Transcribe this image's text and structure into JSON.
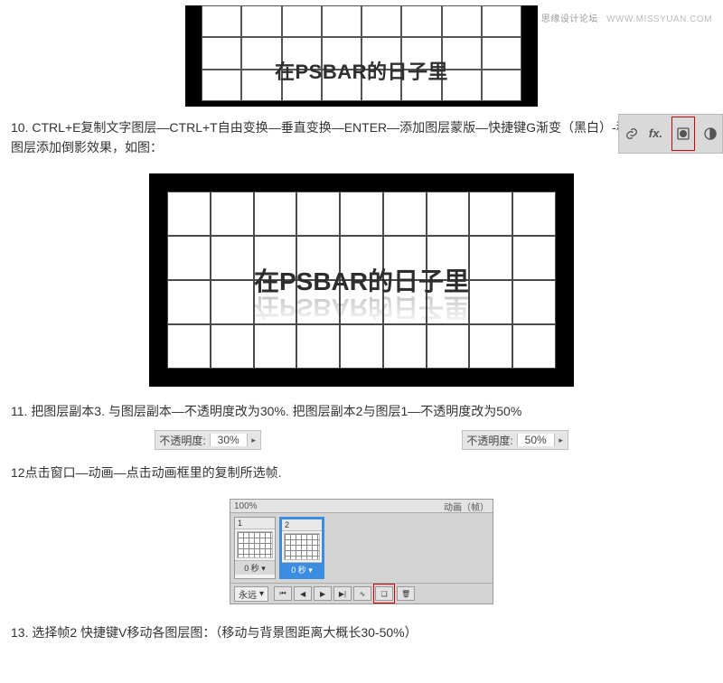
{
  "watermark": {
    "cn": "思缘设计论坛",
    "url": "WWW.MISSYUAN.COM"
  },
  "canvas_text": "在PSBAR的日子里",
  "step10": "10. CTRL+E复制文字图层—CTRL+T自由变换—垂直变换—ENTER—添加图层蒙版—快捷键G渐变（黑白）-移动位置为文字图层添加倒影效果，如图：",
  "step11": "11. 把图层副本3. 与图层副本—不透明度改为30%. 把图层副本2与图层1—不透明度改为50%",
  "opacity": {
    "label": "不透明度:",
    "v1": "30%",
    "v2": "50%"
  },
  "step12": "12点击窗口—动画—点击动画框里的复制所选帧.",
  "anim": {
    "zoom": "100%",
    "tab": "动画（帧）",
    "frame1_num": "1",
    "frame2_num": "2",
    "delay1": "0 秒",
    "delay2": "0 秒",
    "loop": "永远"
  },
  "step13": "13. 选择帧2 快捷键V移动各图层图：（移动与背景图距离大概长30-50%）"
}
